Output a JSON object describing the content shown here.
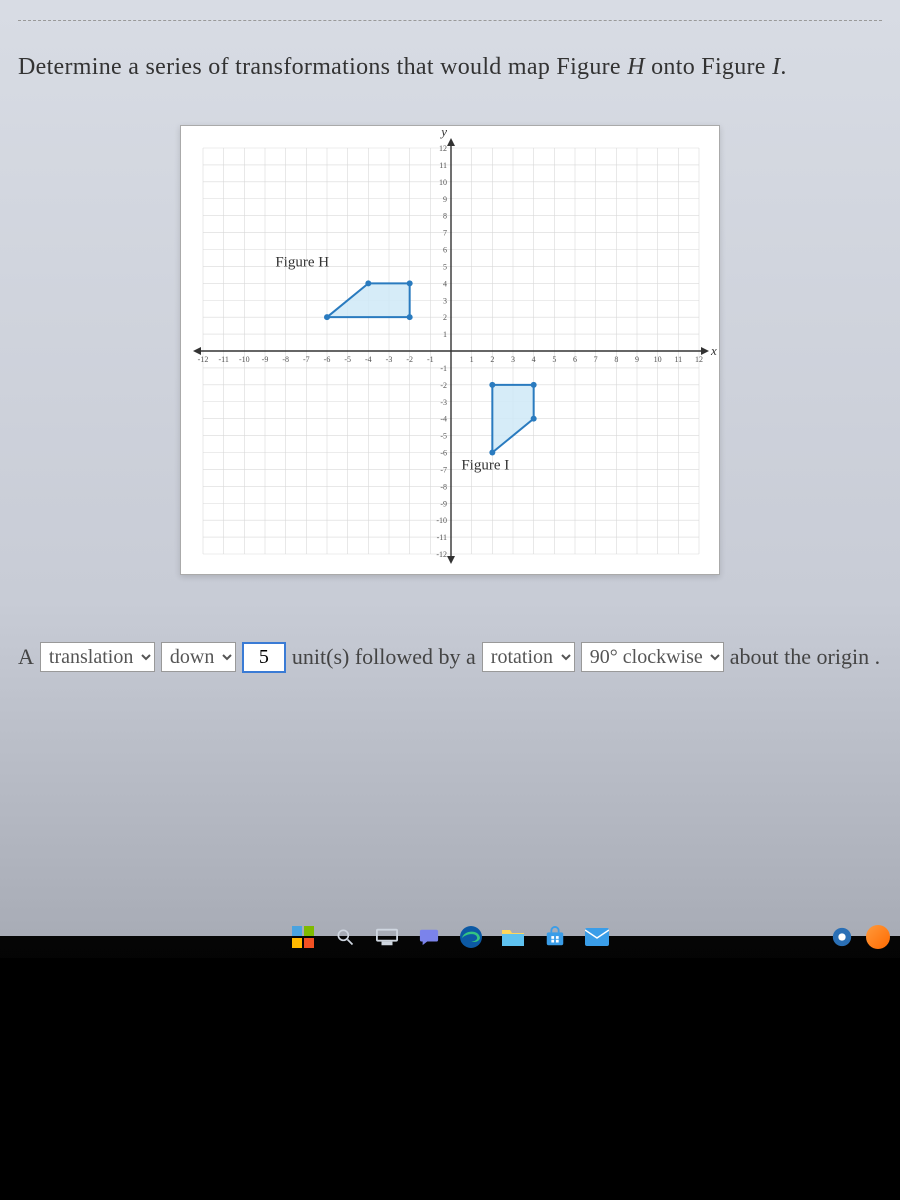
{
  "question": {
    "prefix": "Determine a series of transformations that would map Figure ",
    "figH": "H",
    "mid": " onto Figure ",
    "figI": "I",
    "suffix": "."
  },
  "answer": {
    "txt_A": "A",
    "sel1": "translation",
    "sel2": "down",
    "input_units": "5",
    "txt_units": "unit(s) followed by a",
    "sel3": "rotation",
    "sel4": "90° clockwise",
    "txt_about": "about the origin ."
  },
  "chart_data": {
    "type": "scatter",
    "title": "",
    "xlabel": "x",
    "ylabel": "y",
    "xlim": [
      -12,
      12
    ],
    "ylim": [
      -12,
      12
    ],
    "xticks": [
      -12,
      -11,
      -10,
      -9,
      -8,
      -7,
      -6,
      -5,
      -4,
      -3,
      -2,
      -1,
      1,
      2,
      3,
      4,
      5,
      6,
      7,
      8,
      9,
      10,
      11,
      12
    ],
    "yticks": [
      -12,
      -11,
      -10,
      -9,
      -8,
      -7,
      -6,
      -5,
      -4,
      -3,
      -2,
      -1,
      1,
      2,
      3,
      4,
      5,
      6,
      7,
      8,
      9,
      10,
      11,
      12
    ],
    "annotations": [
      {
        "text": "Figure H",
        "x": -8.5,
        "y": 5
      },
      {
        "text": "Figure I",
        "x": 0.5,
        "y": -7
      }
    ],
    "series": [
      {
        "name": "Figure H",
        "type": "polygon",
        "points": [
          [
            -6,
            2
          ],
          [
            -2,
            2
          ],
          [
            -2,
            4
          ],
          [
            -4,
            4
          ]
        ],
        "fill": "#cfe9f7",
        "stroke": "#2a7bbf"
      },
      {
        "name": "Figure I",
        "type": "polygon",
        "points": [
          [
            2,
            -6
          ],
          [
            2,
            -2
          ],
          [
            4,
            -2
          ],
          [
            4,
            -4
          ]
        ],
        "fill": "#cfe9f7",
        "stroke": "#2a7bbf"
      }
    ]
  },
  "taskbar": {
    "icons": [
      "windows",
      "search",
      "task-view",
      "chat",
      "edge",
      "file-explorer",
      "store",
      "mail",
      "settings",
      "snip"
    ]
  }
}
